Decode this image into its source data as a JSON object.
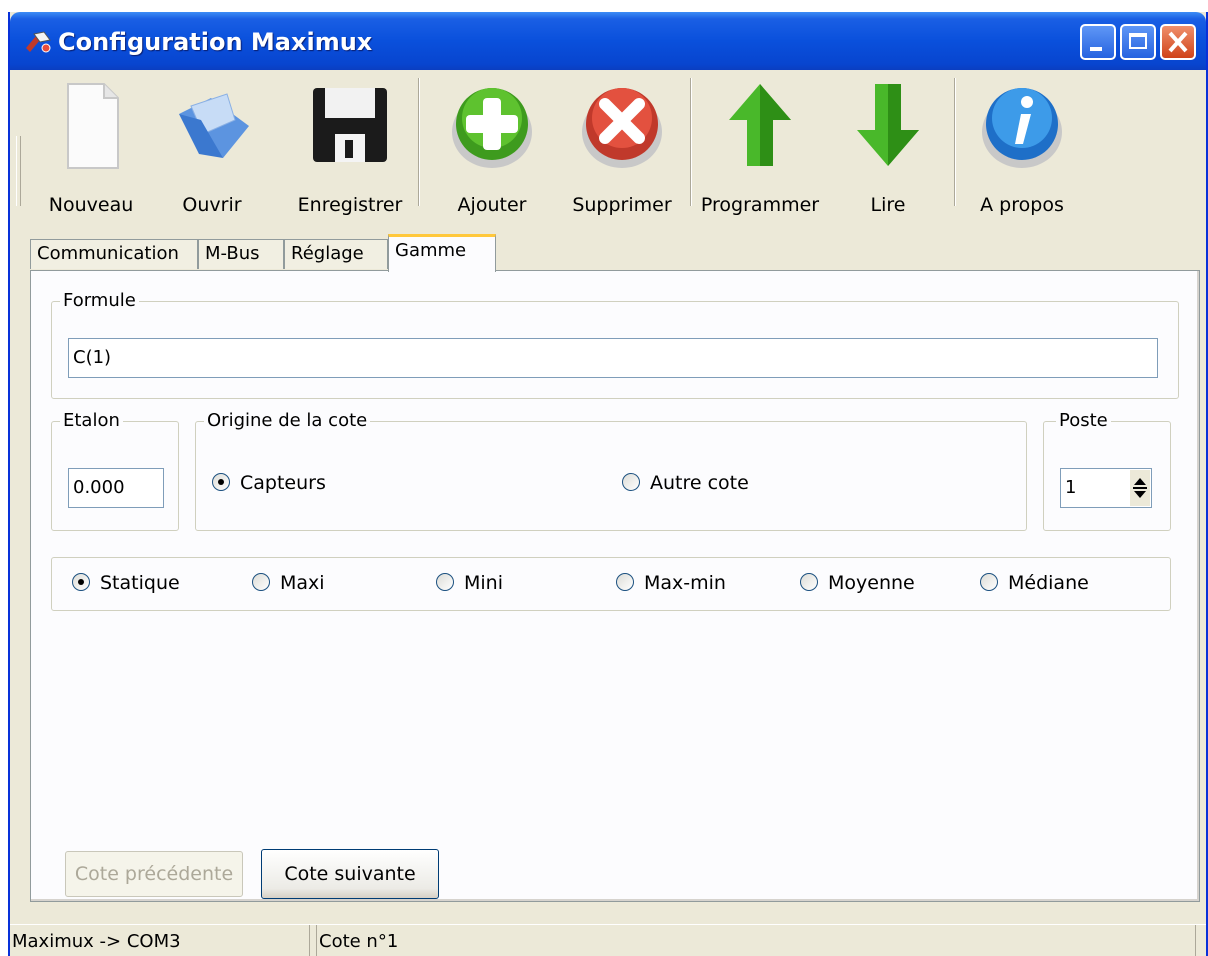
{
  "window": {
    "title": "Configuration Maximux"
  },
  "toolbar": {
    "items": [
      {
        "label": "Nouveau",
        "icon": "new-document-icon"
      },
      {
        "label": "Ouvrir",
        "icon": "open-folder-icon"
      },
      {
        "label": "Enregistrer",
        "icon": "floppy-disk-icon"
      },
      {
        "label": "Ajouter",
        "icon": "green-plus-icon"
      },
      {
        "label": "Supprimer",
        "icon": "red-x-icon"
      },
      {
        "label": "Programmer",
        "icon": "green-up-arrow-icon"
      },
      {
        "label": "Lire",
        "icon": "green-down-arrow-icon"
      },
      {
        "label": "A propos",
        "icon": "info-icon"
      }
    ]
  },
  "tabs": [
    {
      "label": "Communication"
    },
    {
      "label": "M-Bus"
    },
    {
      "label": "Réglage"
    },
    {
      "label": "Gamme",
      "active": true
    }
  ],
  "formule": {
    "legend": "Formule",
    "value": "C(1)"
  },
  "etalon": {
    "legend": "Etalon",
    "value": "0.000"
  },
  "origine": {
    "legend": "Origine de la cote",
    "options": [
      {
        "label": "Capteurs",
        "checked": true
      },
      {
        "label": "Autre cote",
        "checked": false
      }
    ]
  },
  "poste": {
    "legend": "Poste",
    "value": "1"
  },
  "mode": {
    "options": [
      {
        "label": "Statique",
        "checked": true
      },
      {
        "label": "Maxi",
        "checked": false
      },
      {
        "label": "Mini",
        "checked": false
      },
      {
        "label": "Max-min",
        "checked": false
      },
      {
        "label": "Moyenne",
        "checked": false
      },
      {
        "label": "Médiane",
        "checked": false
      }
    ]
  },
  "buttons": {
    "previous": "Cote précédente",
    "next": "Cote suivante"
  },
  "status": {
    "connection": "Maximux -> COM3",
    "cote": "Cote n°1"
  },
  "colors": {
    "titlebar": "#0a50dc",
    "window_border": "#0831d9",
    "tab_highlight": "#ffc83c",
    "close_button": "#d04319"
  }
}
